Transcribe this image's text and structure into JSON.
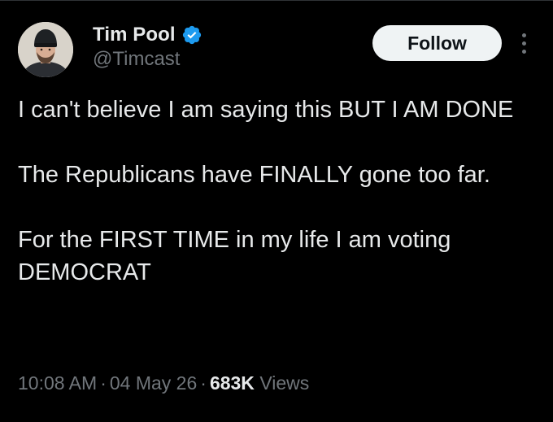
{
  "author": {
    "display_name": "Tim Pool",
    "handle": "@Timcast",
    "verified_icon": "verified-badge-icon",
    "verified_color": "#1d9bf0"
  },
  "actions": {
    "follow_label": "Follow",
    "more_icon": "more-vertical-icon"
  },
  "tweet": {
    "paragraphs": [
      "I can't believe I am saying this BUT I AM DONE",
      "The Republicans have FINALLY gone too far.",
      "For the FIRST TIME in my life I am voting DEMOCRAT"
    ]
  },
  "meta": {
    "time": "10:08 AM",
    "date": "04 May 26",
    "separator": "·",
    "views_count": "683K",
    "views_label": "Views"
  },
  "colors": {
    "background": "#000000",
    "text_primary": "#e7e9ea",
    "text_secondary": "#71767b",
    "follow_button_bg": "#eff3f4"
  }
}
